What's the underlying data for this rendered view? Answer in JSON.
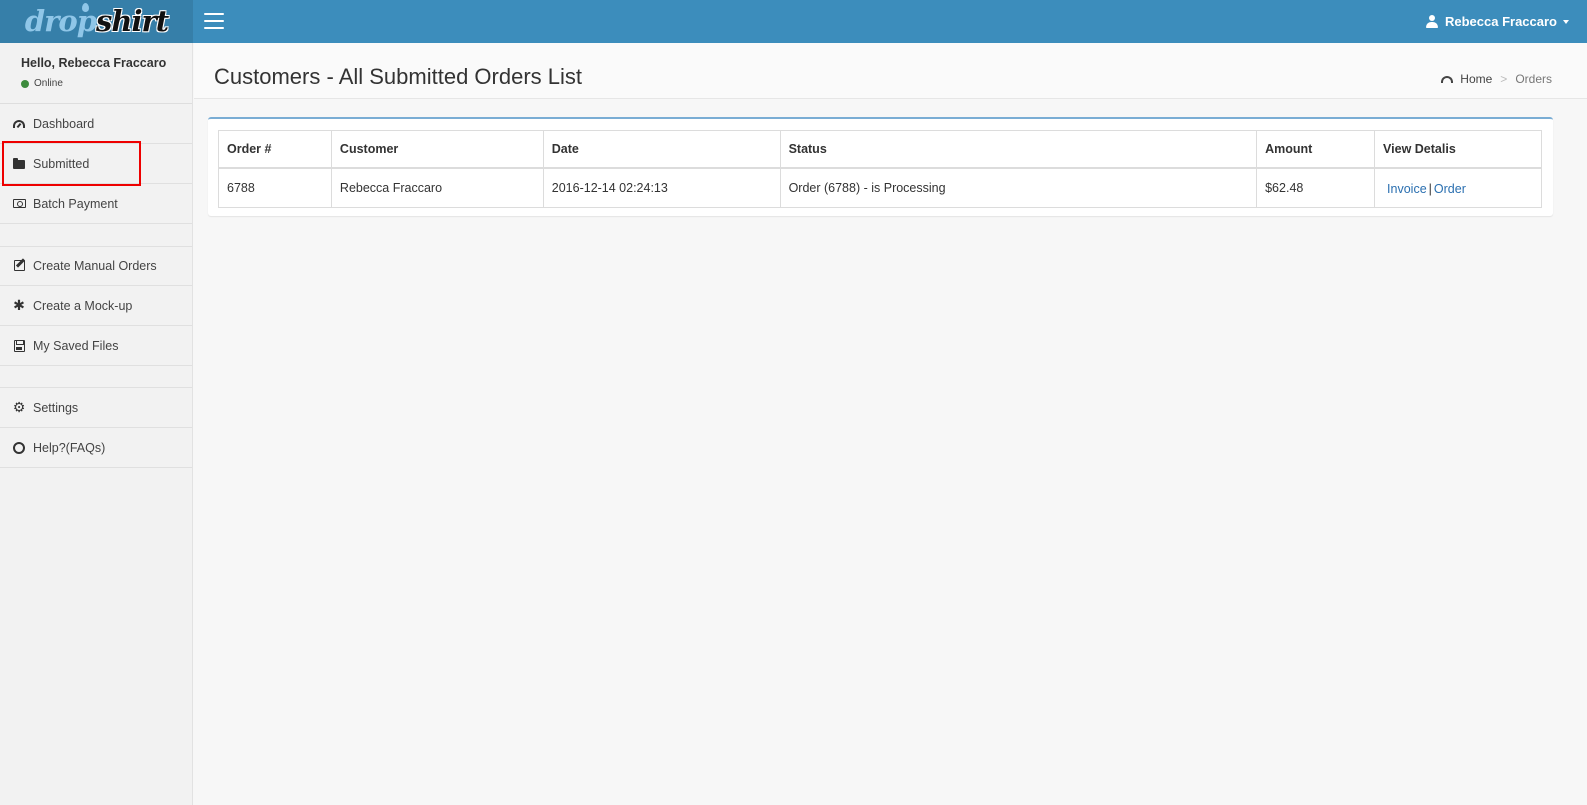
{
  "header": {
    "logo_part1": "drop",
    "logo_part2": "shirt",
    "user_name": "Rebecca Fraccaro"
  },
  "sidebar": {
    "greeting": "Hello, Rebecca Fraccaro",
    "status": "Online",
    "items": [
      {
        "label": "Dashboard",
        "icon": "dashboard-icon"
      },
      {
        "label": "Submitted",
        "icon": "folder-icon"
      },
      {
        "label": "Batch Payment",
        "icon": "money-icon"
      },
      {
        "label": "Create Manual Orders",
        "icon": "edit-icon"
      },
      {
        "label": "Create a Mock-up",
        "icon": "asterisk-icon"
      },
      {
        "label": "My Saved Files",
        "icon": "save-icon"
      },
      {
        "label": "Settings",
        "icon": "gear-icon"
      },
      {
        "label": "Help?(FAQs)",
        "icon": "life-ring-icon"
      }
    ],
    "highlight_color": "#e00000"
  },
  "content": {
    "title": "Customers - All Submitted Orders List",
    "breadcrumb": {
      "home": "Home",
      "current": "Orders"
    },
    "table": {
      "columns": [
        "Order #",
        "Customer",
        "Date",
        "Status",
        "Amount",
        "View Detalis"
      ],
      "rows": [
        {
          "order": "6788",
          "customer": "Rebecca Fraccaro",
          "date": "2016-12-14 02:24:13",
          "status": "Order (6788) - is Processing",
          "amount": "$62.48",
          "link_invoice": "Invoice",
          "link_separator": "|",
          "link_order": "Order"
        }
      ]
    }
  },
  "colors": {
    "header_bg": "#3c8dbc",
    "logo_bg": "#367fa9",
    "box_border": "#7aadd4",
    "link": "#2a6fb0"
  }
}
